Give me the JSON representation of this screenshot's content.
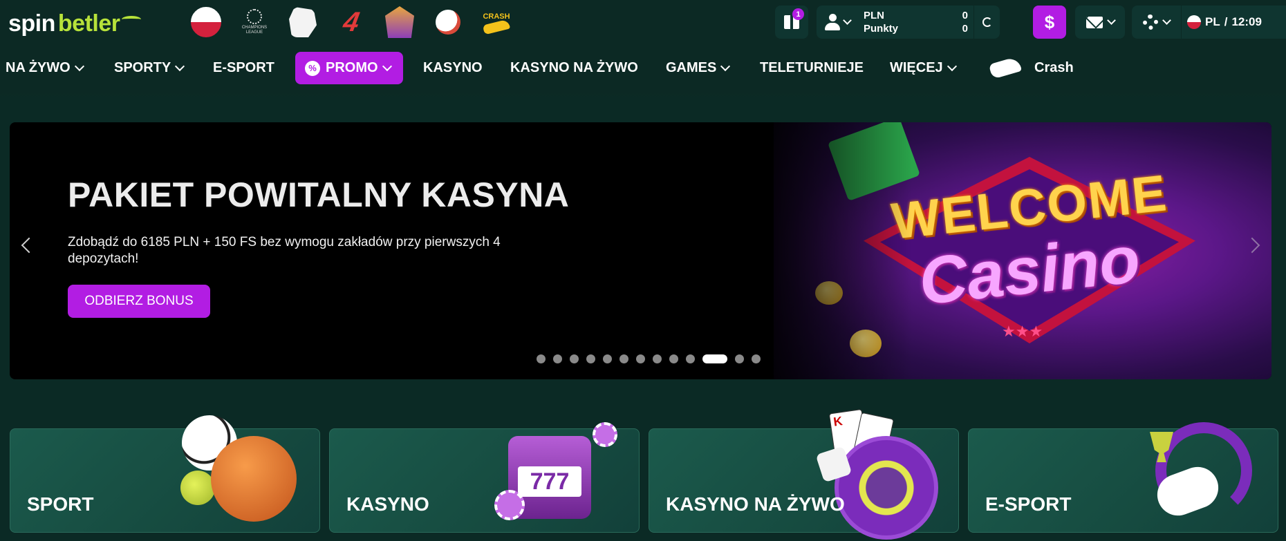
{
  "brand": {
    "part1": "spin",
    "part2": "betler"
  },
  "quick_icons": [
    {
      "name": "poland-flag",
      "label": ""
    },
    {
      "name": "champions-league",
      "label": "CHAMPIONS LEAGUE"
    },
    {
      "name": "premier-league",
      "label": ""
    },
    {
      "name": "laliga",
      "label": "4"
    },
    {
      "name": "games-badge",
      "label": ""
    },
    {
      "name": "chicken-game",
      "label": ""
    },
    {
      "name": "crash-game",
      "label": "CRASH"
    }
  ],
  "header": {
    "gift_count": "1",
    "currency_label": "PLN",
    "currency_value": "0",
    "points_label": "Punkty",
    "points_value": "0",
    "deposit_symbol": "$",
    "language": "PL",
    "separator": "/",
    "time": "12:09"
  },
  "nav": {
    "live": "NA ŻYWO",
    "sports": "SPORTY",
    "esport": "E-SPORT",
    "promo": "PROMO",
    "promo_icon": "%",
    "casino": "KASYNO",
    "live_casino": "KASYNO NA ŻYWO",
    "games": "GAMES",
    "game_shows": "TELETURNIEJE",
    "more": "WIĘCEJ",
    "crash": "Crash"
  },
  "hero": {
    "title": "PAKIET POWITALNY KASYNA",
    "subtitle": "Zdobądź do 6185 PLN + 150 FS bez wymogu zakładów przy pierwszych 4 depozytach!",
    "button": "ODBIERZ BONUS",
    "art_line1": "WELCOME",
    "art_line2": "Casino",
    "slide_count": 13,
    "active_slide": 11
  },
  "cards": {
    "sport": "SPORT",
    "casino": "KASYNO",
    "live_casino": "KASYNO NA ŻYWO",
    "esport": "E-SPORT",
    "ace_label": "K"
  },
  "colors": {
    "background": "#0b2a25",
    "accent_purple": "#b21de3",
    "brand_green": "#b7e23a",
    "card_green": "#1b5a4c"
  }
}
